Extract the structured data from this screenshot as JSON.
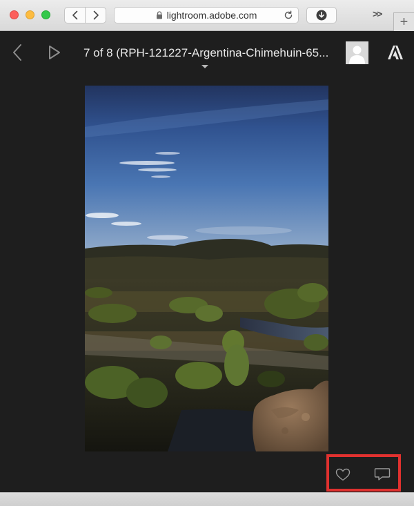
{
  "browser": {
    "url_text": "lightroom.adobe.com",
    "icons": {
      "back": "chevron-left-icon",
      "forward": "chevron-right-icon",
      "lock": "lock-icon",
      "reload": "reload-icon",
      "download": "download-icon",
      "overflow": "overflow-chevrons-icon",
      "new_tab": "plus-icon"
    },
    "overflow_label": ">>",
    "new_tab_label": "+"
  },
  "viewer": {
    "title": "7 of 8 (RPH-121227-Argentina-Chimehuin-65...",
    "icons": {
      "previous": "chevron-left-icon",
      "slideshow": "play-icon",
      "title_menu": "caret-down-icon",
      "avatar": "user-avatar-icon",
      "adobe": "adobe-logo-icon",
      "like": "heart-icon",
      "comment": "comment-icon"
    }
  },
  "photo": {
    "subject": "landscape-photo"
  },
  "colors": {
    "background": "#1e1e1e",
    "highlight": "#e0312f",
    "icon": "#9a9a9a",
    "title_text": "#e8e8e8"
  }
}
